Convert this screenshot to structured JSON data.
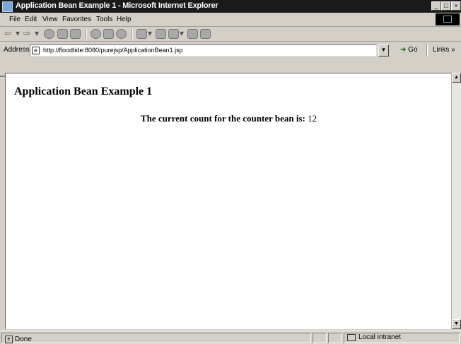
{
  "window": {
    "title": "Application Bean Example 1 - Microsoft Internet Explorer",
    "buttons": {
      "minimize": "_",
      "maximize": "□",
      "close": "×"
    }
  },
  "menu": {
    "items": [
      "File",
      "Edit",
      "View",
      "Favorites",
      "Tools",
      "Help"
    ]
  },
  "address": {
    "label": "Address",
    "url": "http://floodtide:8080/purejsp/ApplicationBean1.jsp",
    "go_label": "Go",
    "links_label": "Links »"
  },
  "page": {
    "heading": "Application Bean Example 1",
    "message_label": "The current count for the counter bean is:",
    "count_value": "12"
  },
  "status": {
    "text": "Done",
    "zone": "Local intranet"
  }
}
